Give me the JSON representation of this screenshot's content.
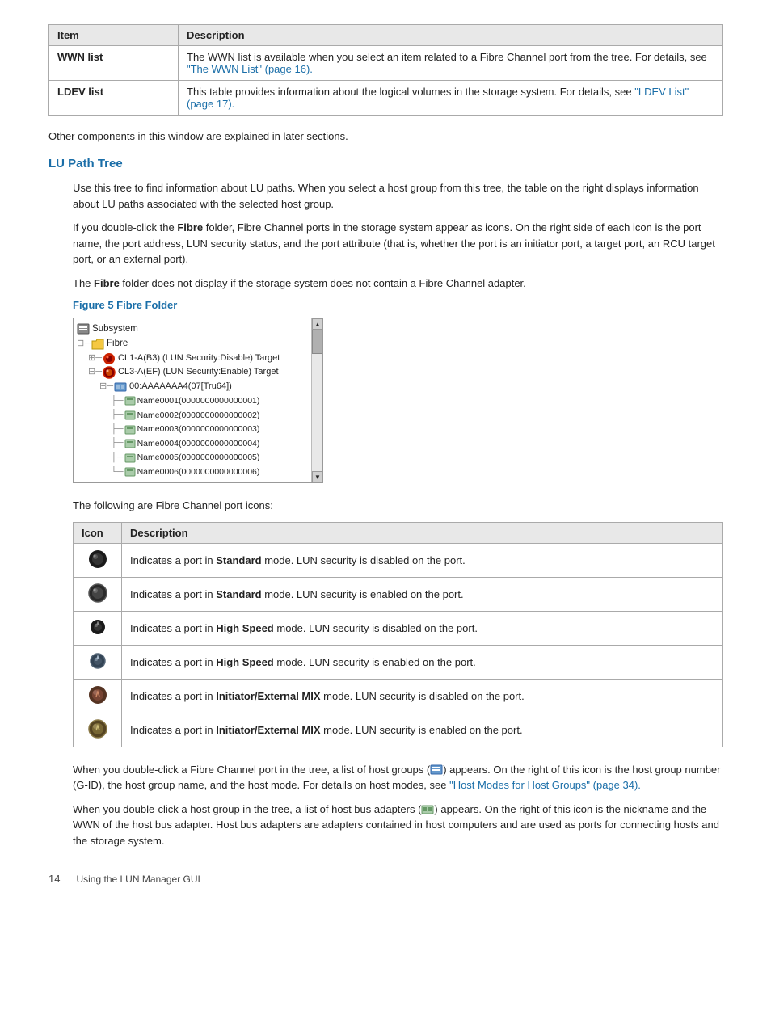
{
  "top_table": {
    "headers": [
      "Item",
      "Description"
    ],
    "rows": [
      {
        "item": "WWN list",
        "description_plain": "The WWN list is available when you select an item related to a Fibre Channel port from the tree. For details, see ",
        "description_link": "\"The WWN List\" (page 16).",
        "description_after": ""
      },
      {
        "item": "LDEV list",
        "description_plain": "This table provides information about the logical volumes in the storage system. For details, see ",
        "description_link": "\"LDEV List\" (page 17).",
        "description_after": ""
      }
    ]
  },
  "other_components_text": "Other components in this window are explained in later sections.",
  "lu_path_tree": {
    "heading": "LU Path Tree",
    "para1": "Use this tree to find information about LU paths. When you select a host group from this tree, the table on the right displays information about LU paths associated with the selected host group.",
    "para2_before_bold": "If you double-click the ",
    "para2_bold": "Fibre",
    "para2_after": " folder, Fibre Channel ports in the storage system appear as icons. On the right side of each icon is the port name, the port address, LUN security status, and the port attribute (that is, whether the port is an initiator port, a target port, an RCU target port, or an external port).",
    "para3_before_bold": "The ",
    "para3_bold": "Fibre",
    "para3_after": " folder does not display if the storage system does not contain a Fibre Channel adapter.",
    "figure_heading": "Figure 5 Fibre Folder",
    "tree": {
      "nodes": [
        {
          "indent": 0,
          "expand": "",
          "icon": "subsystem",
          "label": "Subsystem"
        },
        {
          "indent": 0,
          "expand": "⊟",
          "icon": "folder",
          "label": "Fibre"
        },
        {
          "indent": 1,
          "expand": "⊞",
          "icon": "port-disable",
          "label": "CL1-A(B3) (LUN Security:Disable) Target"
        },
        {
          "indent": 1,
          "expand": "⊟",
          "icon": "port-enable",
          "label": "CL3-A(EF) (LUN Security:Enable) Target"
        },
        {
          "indent": 2,
          "expand": "⊟",
          "icon": "hba",
          "label": "00:AAAAAAA4(07[Tru64])"
        },
        {
          "indent": 3,
          "expand": "",
          "icon": "lun",
          "label": "Name0001(0000000000000001)"
        },
        {
          "indent": 3,
          "expand": "",
          "icon": "lun",
          "label": "Name0002(0000000000000002)"
        },
        {
          "indent": 3,
          "expand": "",
          "icon": "lun",
          "label": "Name0003(0000000000000003)"
        },
        {
          "indent": 3,
          "expand": "",
          "icon": "lun",
          "label": "Name0004(0000000000000004)"
        },
        {
          "indent": 3,
          "expand": "",
          "icon": "lun",
          "label": "Name0005(0000000000000005)"
        },
        {
          "indent": 3,
          "expand": "",
          "icon": "lun",
          "label": "Name0006(0000000000000006)"
        }
      ]
    },
    "following_text": "The following are Fibre Channel port icons:",
    "icon_table": {
      "headers": [
        "Icon",
        "Description"
      ],
      "rows": [
        {
          "icon_type": "bp-1",
          "desc_plain": "Indicates a port in ",
          "desc_bold": "Standard",
          "desc_after": " mode. LUN security is disabled on the port."
        },
        {
          "icon_type": "bp-2",
          "desc_plain": "Indicates a port in ",
          "desc_bold": "Standard",
          "desc_after": " mode. LUN security is enabled on the port."
        },
        {
          "icon_type": "bp-3",
          "desc_plain": "Indicates a port in ",
          "desc_bold": "High Speed",
          "desc_after": " mode. LUN security is disabled on the port."
        },
        {
          "icon_type": "bp-4",
          "desc_plain": "Indicates a port in ",
          "desc_bold": "High Speed",
          "desc_after": " mode. LUN security is enabled on the port."
        },
        {
          "icon_type": "bp-5",
          "desc_plain": "Indicates a port in ",
          "desc_bold": "Initiator/External MIX",
          "desc_after": " mode. LUN security is disabled on the port."
        },
        {
          "icon_type": "bp-6",
          "desc_plain": "Indicates a port in ",
          "desc_bold": "Initiator/External MIX",
          "desc_after": " mode. LUN security is enabled on the port."
        }
      ]
    },
    "para4_before": "When you double-click a Fibre Channel port in the tree, a list of host groups (",
    "para4_icon": "🖥",
    "para4_after": ") appears. On the right of this icon is the host group number (G-ID), the host group name, and the host mode. For details on host modes, see ",
    "para4_link": "\"Host Modes for Host Groups\" (page 34).",
    "para5_before": "When you double-click a host group in the tree, a list of host bus adapters (",
    "para5_icon": "🖥",
    "para5_after": ") appears. On the right of this icon is the nickname and the WWN of the host bus adapter. Host bus adapters are adapters contained in host computers and are used as ports for connecting hosts and the storage system."
  },
  "footer": {
    "page_number": "14",
    "text": "Using the LUN Manager GUI"
  }
}
